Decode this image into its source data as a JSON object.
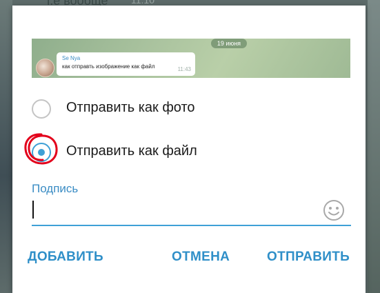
{
  "background": {
    "chat_text": "т.е вообще",
    "chat_time": "11:10"
  },
  "preview": {
    "date": "19 июня",
    "message": {
      "sender": "Se Nya",
      "text": "как отправть изображение как файл",
      "time": "11:43"
    }
  },
  "options": [
    {
      "label": "Отправить как фото",
      "selected": false
    },
    {
      "label": "Отправить как файл",
      "selected": true
    }
  ],
  "caption": {
    "label": "Подпись",
    "value": ""
  },
  "buttons": {
    "add": "ДОБАВИТЬ",
    "cancel": "ОТМЕНА",
    "send": "ОТПРАВИТЬ"
  },
  "colors": {
    "accent": "#3ea0d6",
    "button_text": "#2f8fc8",
    "annotation": "#e3001b"
  },
  "icons": {
    "emoji": "smiley-face-icon"
  }
}
